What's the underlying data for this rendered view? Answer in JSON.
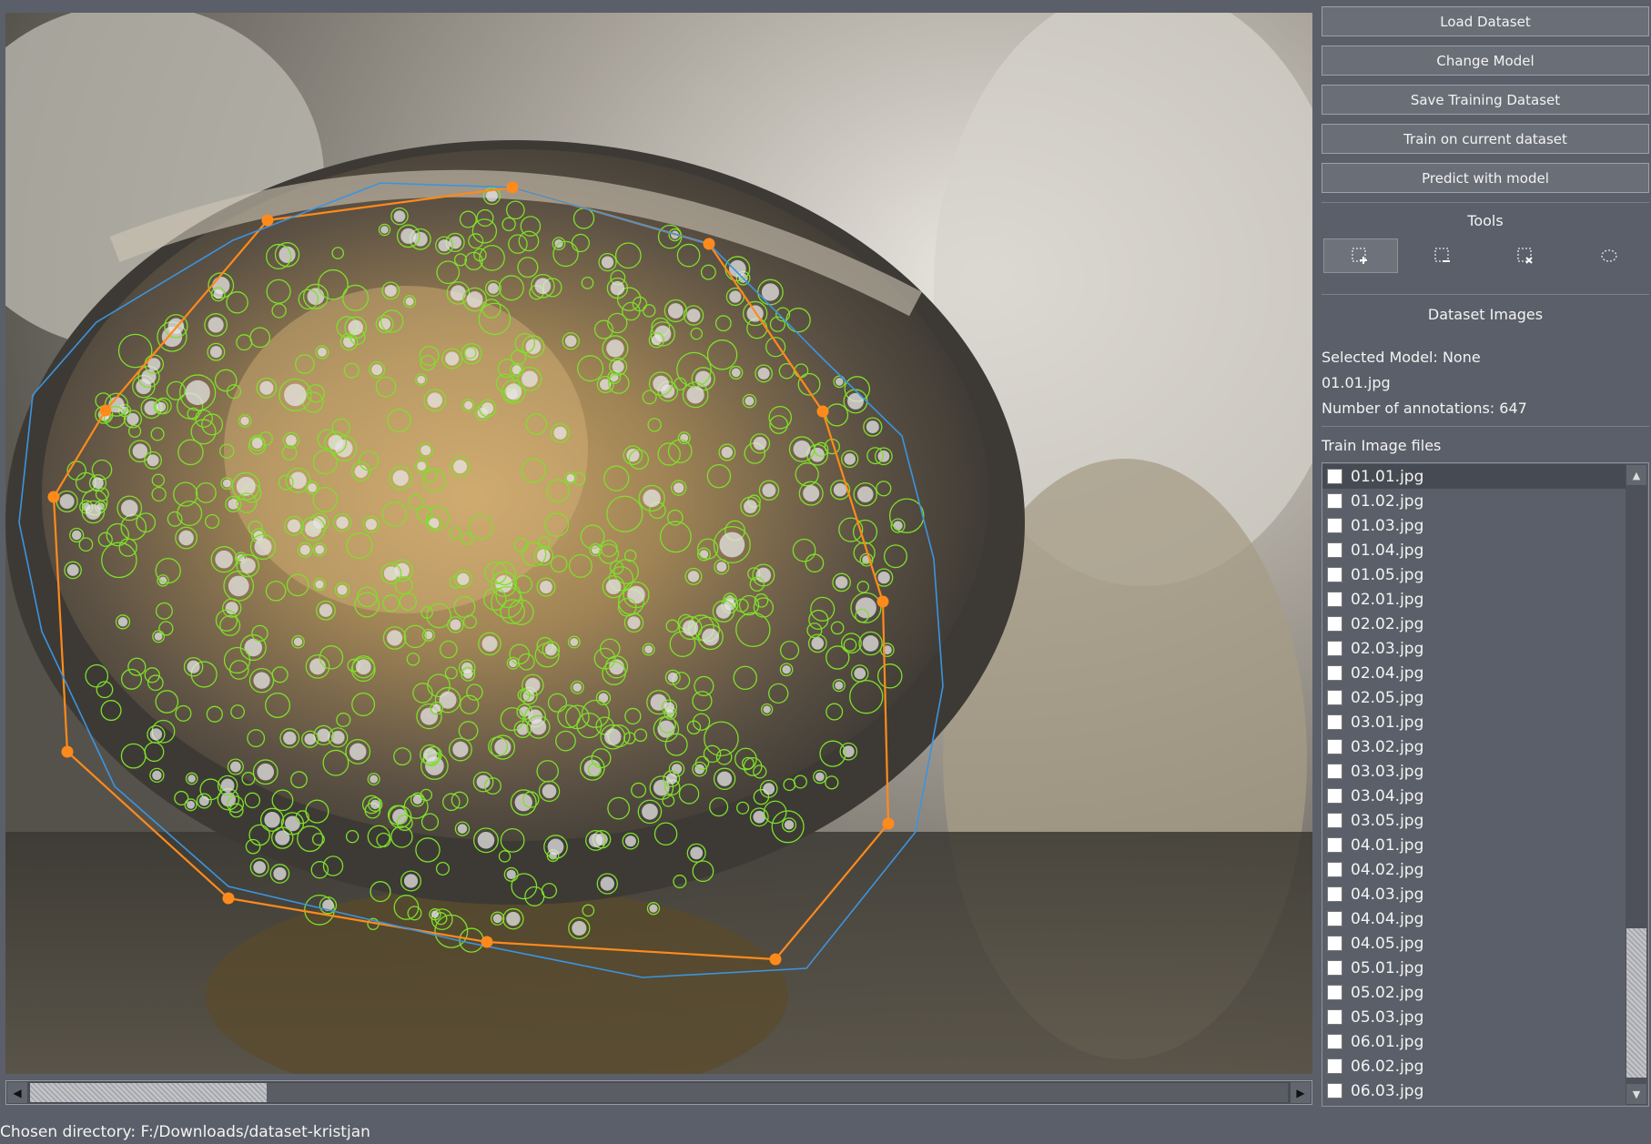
{
  "viewer": {
    "image_name": "01.01.jpg",
    "annotation_color": "#7ee02a",
    "orange_polygon_color": "#ff8a1c",
    "blue_polygon_color": "#3b94e0"
  },
  "toolbar": {
    "load_dataset": "Load Dataset",
    "change_model": "Change Model",
    "save_training_dataset": "Save Training Dataset",
    "train_on_current_dataset": "Train on current dataset",
    "predict_with_model": "Predict with model"
  },
  "tools": {
    "title": "Tools",
    "items": [
      {
        "icon": "add-selection-icon",
        "active": true
      },
      {
        "icon": "subtract-selection-icon",
        "active": false
      },
      {
        "icon": "delete-selection-icon",
        "active": false
      },
      {
        "icon": "ellipse-tool-icon",
        "active": false
      }
    ]
  },
  "dataset": {
    "title": "Dataset Images",
    "selected_model": "Selected Model: None",
    "current_file": "01.01.jpg",
    "annotation_count": "Number of annotations: 647"
  },
  "filelist": {
    "title": "Train  Image files",
    "files": [
      "01.01.jpg",
      "01.02.jpg",
      "01.03.jpg",
      "01.04.jpg",
      "01.05.jpg",
      "02.01.jpg",
      "02.02.jpg",
      "02.03.jpg",
      "02.04.jpg",
      "02.05.jpg",
      "03.01.jpg",
      "03.02.jpg",
      "03.03.jpg",
      "03.04.jpg",
      "03.05.jpg",
      "04.01.jpg",
      "04.02.jpg",
      "04.03.jpg",
      "04.04.jpg",
      "04.05.jpg",
      "05.01.jpg",
      "05.02.jpg",
      "05.03.jpg",
      "06.01.jpg",
      "06.02.jpg",
      "06.03.jpg"
    ],
    "selected_index": 0
  },
  "status": {
    "directory": "Chosen directory: F:/Downloads/dataset-kristjan"
  }
}
